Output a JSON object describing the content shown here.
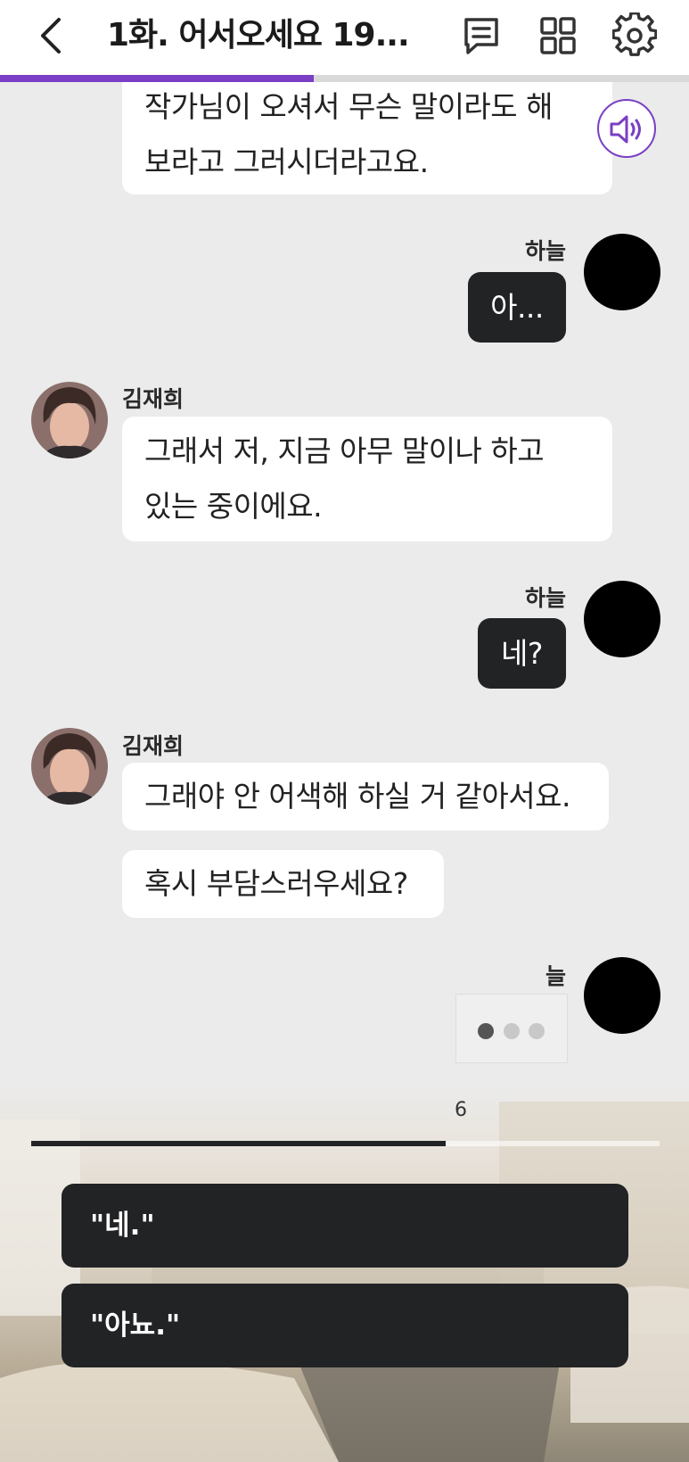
{
  "header": {
    "title": "1화. 어서오세요 19...",
    "progress_fraction": 0.455
  },
  "icons": {
    "back": "chevron-left-icon",
    "log": "chat-log-icon",
    "grid": "grid-icon",
    "settings": "gear-icon",
    "sound": "speaker-icon"
  },
  "colors": {
    "accent": "#7a3fc4",
    "bubble_dark": "#222325",
    "bubble_light": "#ffffff",
    "background": "#ebebeb"
  },
  "chat": {
    "msg0_line1": "작가님이 오셔서 무슨 말이라도 해",
    "msg0_line2": "보라고 그러시더라고요.",
    "user_name": "하늘",
    "msg1": "아...",
    "npc_name": "김재희",
    "msg2_line1": "그래서 저, 지금 아무 말이나 하고",
    "msg2_line2": "있는 중이에요.",
    "user_name_2": "하늘",
    "msg3": "네?",
    "npc_name_2": "김재희",
    "msg4": "그래야 안 어색해 하실 거 같아서요.",
    "msg5": "혹시 부담스러우세요?",
    "user_name_partial": "늘"
  },
  "choices": {
    "timer_value": "6",
    "timer_fraction": 0.66,
    "option1": "\"네.\"",
    "option2": "\"아뇨.\""
  }
}
